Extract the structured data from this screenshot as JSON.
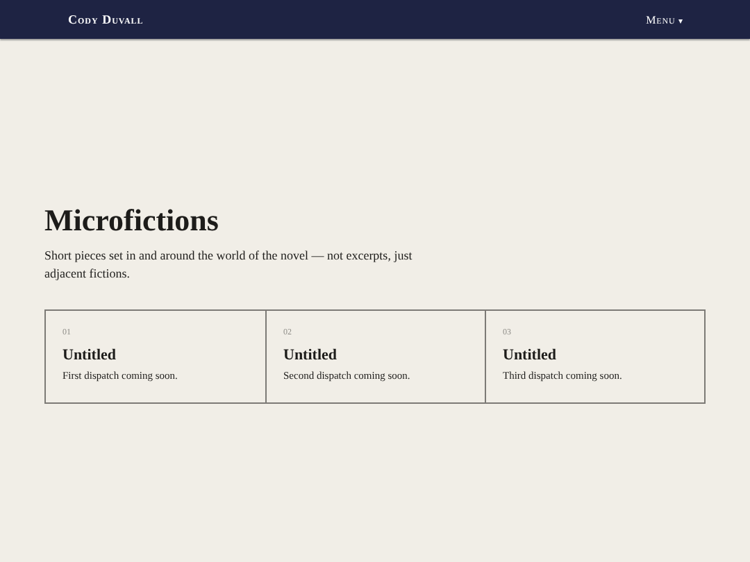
{
  "header": {
    "brand": "Cody Duvall",
    "menu": "Menu",
    "menu_caret": "▾"
  },
  "title": "Microfictions",
  "intro": "Short pieces set in and around the world of the novel — not excerpts, just adjacent fictions.",
  "cards": [
    {
      "number": "01",
      "title": "Untitled",
      "text": "First dispatch coming soon."
    },
    {
      "number": "02",
      "title": "Untitled",
      "text": "Second dispatch coming soon."
    },
    {
      "number": "03",
      "title": "Untitled",
      "text": "Third dispatch coming soon."
    }
  ]
}
